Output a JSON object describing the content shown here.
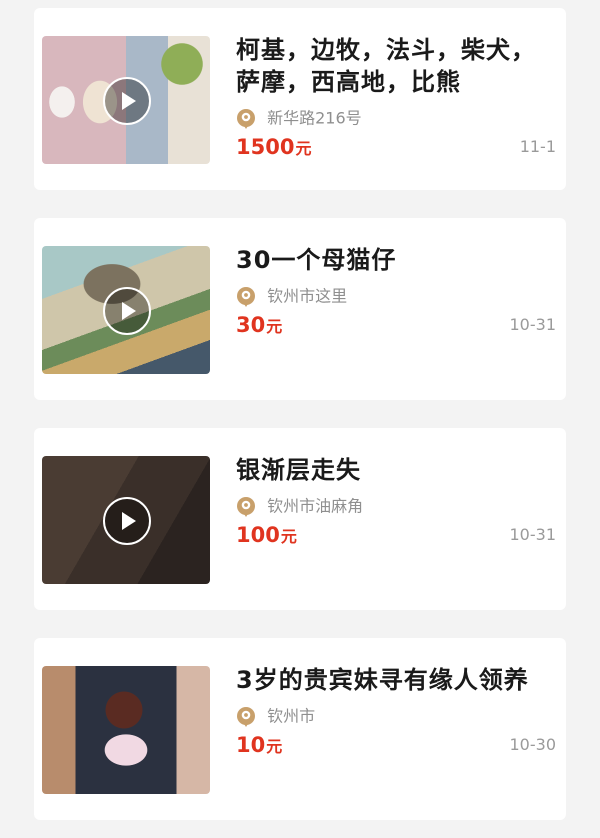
{
  "listings": [
    {
      "title": "柯基，边牧，法斗，柴犬，萨摩，西高地，比熊",
      "location": "新华路216号",
      "price": "1500",
      "unit": "元",
      "date": "11-1"
    },
    {
      "title": "30一个母猫仔",
      "location": "钦州市这里",
      "price": "30",
      "unit": "元",
      "date": "10-31"
    },
    {
      "title": "银渐层走失",
      "location": "钦州市油麻角",
      "price": "100",
      "unit": "元",
      "date": "10-31"
    },
    {
      "title": "3岁的贵宾妹寻有缘人领养",
      "location": "钦州市",
      "price": "10",
      "unit": "元",
      "date": "10-30"
    }
  ],
  "icons": {
    "play": "play-icon",
    "location": "location-pin-icon"
  },
  "colors": {
    "price": "#e0341f",
    "location_icon": "#c8a06b",
    "meta_text": "#8f8f8f"
  }
}
